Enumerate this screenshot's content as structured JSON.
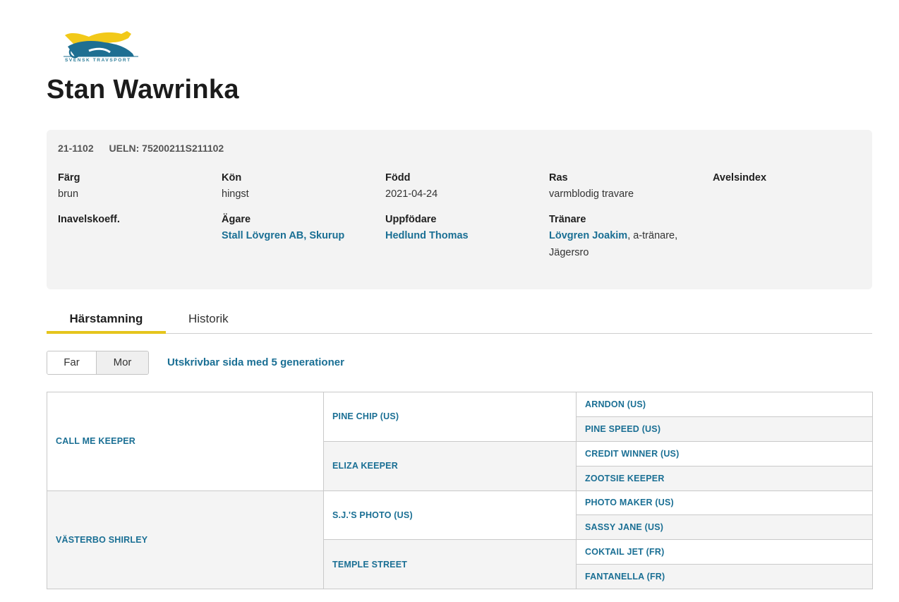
{
  "logo": {
    "text": "SVENSK TRAVSPORT"
  },
  "colors": {
    "link": "#1a6f94",
    "accent": "#e5c51c",
    "box": "#f3f3f3"
  },
  "horse": {
    "name": "Stan Wawrinka",
    "reg_no": "21-1102",
    "ueln": "UELN: 75200211S211102"
  },
  "info": {
    "color_label": "Färg",
    "color_value": "brun",
    "sex_label": "Kön",
    "sex_value": "hingst",
    "born_label": "Född",
    "born_value": "2021-04-24",
    "breed_label": "Ras",
    "breed_value": "varmblodig travare",
    "index_label": "Avelsindex",
    "inbreeding_label": "Inavelskoeff.",
    "owner_label": "Ägare",
    "owner_value": "Stall Lövgren AB, Skurup",
    "breeder_label": "Uppfödare",
    "breeder_value": "Hedlund Thomas",
    "trainer_label": "Tränare",
    "trainer_name": "Lövgren Joakim",
    "trainer_rest": ", a-tränare,",
    "trainer_place": "Jägersro"
  },
  "tabs": {
    "pedigree": "Härstamning",
    "history": "Historik"
  },
  "toggle": {
    "far": "Far",
    "mor": "Mor"
  },
  "print_link": "Utskrivbar sida med 5 generationer",
  "pedigree": {
    "sire": "CALL ME KEEPER",
    "dam": "VÄSTERBO SHIRLEY",
    "ss": "PINE CHIP (US)",
    "sd": "ELIZA KEEPER",
    "ds": "S.J.'S PHOTO (US)",
    "dd": "TEMPLE STREET",
    "sss": "ARNDON (US)",
    "ssd": "PINE SPEED (US)",
    "sds": "CREDIT WINNER (US)",
    "sdd": "ZOOTSIE KEEPER",
    "dss": "PHOTO MAKER (US)",
    "dsd": "SASSY JANE (US)",
    "dds": "COKTAIL JET (FR)",
    "ddd": "FANTANELLA (FR)"
  }
}
